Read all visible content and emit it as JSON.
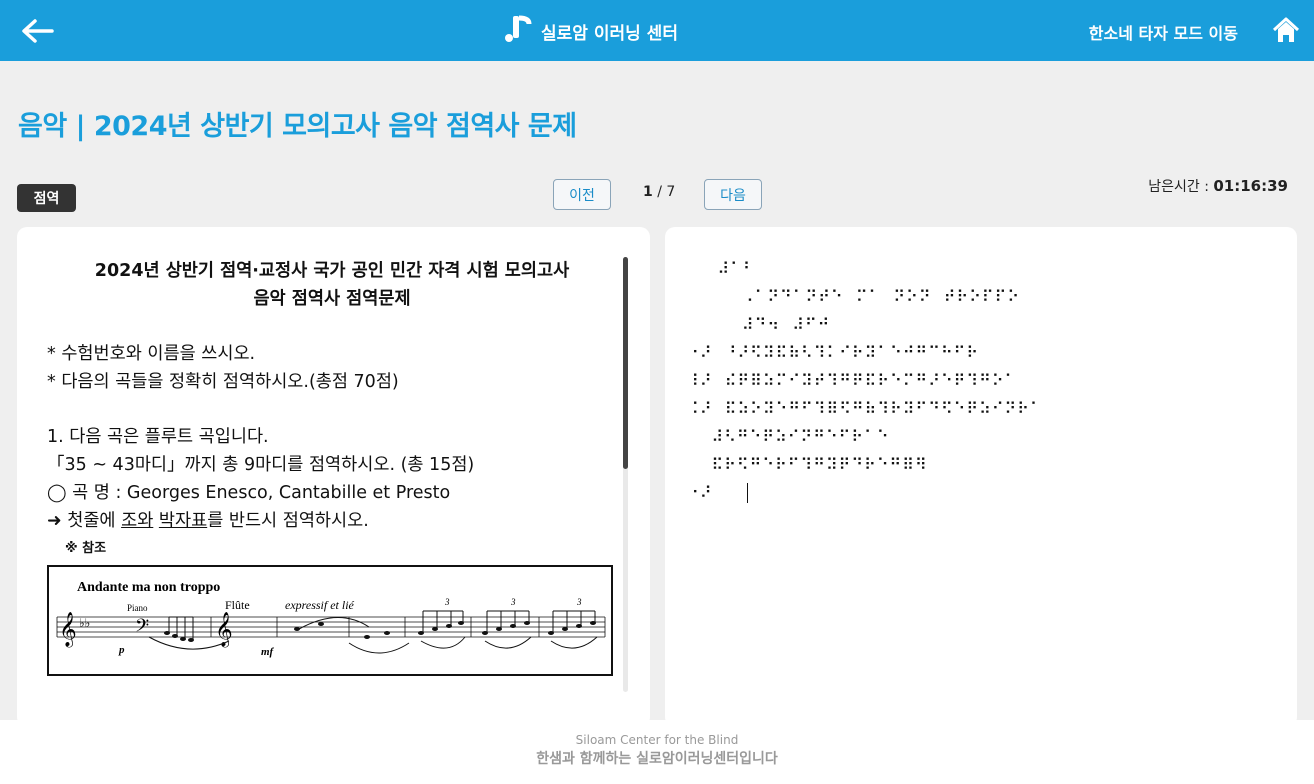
{
  "header": {
    "brand_name": "실로암 이러닝 센터",
    "mode_link": "한소네 타자 모드 이동",
    "icons": {
      "back": "back-arrow-icon",
      "logo": "siloam-logo-icon",
      "home": "home-icon"
    },
    "colors": {
      "accent": "#1a9edb"
    }
  },
  "page": {
    "title": "음악 | 2024년 상반기 모의고사 음악 점역사 문제"
  },
  "toolbar": {
    "tag": "점역",
    "prev_label": "이전",
    "next_label": "다음",
    "current_page": "1",
    "separator": " / ",
    "total_pages": "7",
    "timer_label": "남은시간 : ",
    "timer_value": "01:16:39"
  },
  "question": {
    "title_line1": "2024년 상반기 점역·교정사 국가 공인 민간 자격 시험 모의고사",
    "title_line2": "음악 점역사 점역문제",
    "instruction1": "* 수험번호와 이름을 쓰시오.",
    "instruction2": "* 다음의 곡들을 정확히 점역하시오.(총점 70점)",
    "q1_line1": "1. 다음 곡은 플루트 곡입니다.",
    "q1_line2": "「35 ~ 43마디」까지 총 9마디를 점역하시오. (총 15점)",
    "q1_line3": "◯ 곡 명 : Georges Enesco, Cantabille et Presto",
    "q1_line4_prefix": "➜ 첫줄에 ",
    "q1_line4_u1": "조와",
    "q1_line4_space": " ",
    "q1_line4_u2": "박자표",
    "q1_line4_suffix": "를 반드시 점역하시오.",
    "note": "※ 참조",
    "score": {
      "tempo": "Andante ma non troppo",
      "piano": "Piano",
      "flute": "Flûte",
      "expression": "expressif et lié",
      "dyn_p": "p",
      "dyn_mf": "mf",
      "triplet": "3"
    }
  },
  "answer": {
    "lines": [
      "     ⠼⠁⠃",
      "",
      "         ⠠⠁⠝⠙⠁⠝⠞⠑  ⠍⠁  ⠝⠕⠝  ⠞⠗⠕⠏⠏⠕",
      "         ⠼⠙⠲  ⠼⠋⠚",
      "⠐⠜  ⠘⠜⠫⠽⠯⠷⠣⠹⠅⠊⠗⠽⠁⠑⠚⠛⠉⠓⠋⠗",
      "⠸⠜  ⠮⠟⠿⠵⠍⠊⠽⠞⠹⠛⠟⠯⠗⠑⠍⠛⠜⠑⠟⠹⠛⠕⠁",
      "⠨⠜  ⠯⠵⠕⠽⠑⠛⠋⠹⠿⠫⠛⠷⠹⠗⠽⠋⠙⠫⠑⠟⠵⠊⠝⠗⠁",
      "    ⠼⠣⠛⠑⠟⠵⠊⠝⠛⠑⠋⠗⠁⠑",
      "    ⠯⠗⠫⠛⠑⠗⠋⠹⠛⠽⠟⠙⠗⠑⠛⠿⠻",
      "⠐⠜ "
    ]
  },
  "footer": {
    "english": "Siloam Center for the Blind",
    "korean": "한샘과 함께하는 실로암이러닝센터입니다"
  }
}
